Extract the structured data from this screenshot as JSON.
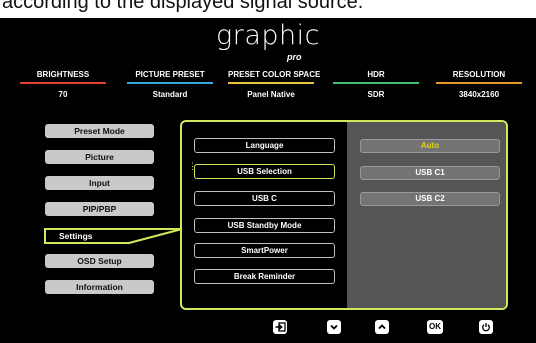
{
  "caption_fragment": "according to the displayed signal source.",
  "logo": {
    "word": "graphic",
    "sub": "pro"
  },
  "status": [
    {
      "label": "BRIGHTNESS",
      "value": "70",
      "color": "#e0412e"
    },
    {
      "label": "PICTURE PRESET",
      "value": "Standard",
      "color": "#3aa8d8"
    },
    {
      "label": "PRESET COLOR SPACE",
      "value": "Panel Native",
      "color": "#e8c23a"
    },
    {
      "label": "HDR",
      "value": "SDR",
      "color": "#3fbf6a"
    },
    {
      "label": "RESOLUTION",
      "value": "3840x2160",
      "color": "#e89a2e"
    }
  ],
  "main_menu": [
    "Preset Mode",
    "Picture",
    "Input",
    "PIP/PBP",
    "Settings",
    "OSD Setup",
    "Information"
  ],
  "main_menu_active": "Settings",
  "settings_menu": [
    "Language",
    "USB Selection",
    "USB C",
    "USB Standby Mode",
    "SmartPower",
    "Break Reminder"
  ],
  "settings_selected": "USB Selection",
  "options": [
    "Auto",
    "USB C1",
    "USB C2"
  ],
  "option_selected": "Auto",
  "nav": {
    "exit_icon": "exit-icon",
    "down_icon": "chevron-down-icon",
    "up_icon": "chevron-up-icon",
    "ok_label": "OK",
    "power_icon": "power-icon"
  },
  "accent_color": "#d6e65a"
}
